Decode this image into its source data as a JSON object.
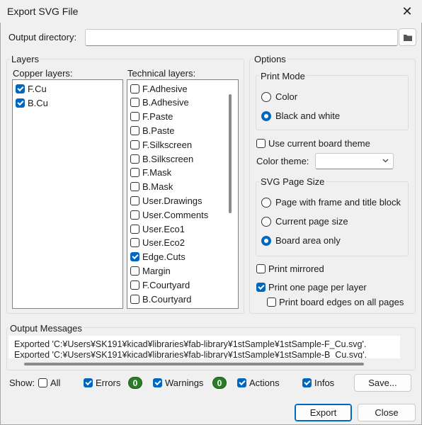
{
  "window": {
    "title": "Export SVG File"
  },
  "output_dir": {
    "label": "Output directory:",
    "value": ""
  },
  "layers": {
    "title": "Layers",
    "copper_label": "Copper layers:",
    "copper": [
      {
        "name": "F.Cu",
        "checked": true
      },
      {
        "name": "B.Cu",
        "checked": true
      }
    ],
    "technical_label": "Technical layers:",
    "technical": [
      {
        "name": "F.Adhesive",
        "checked": false
      },
      {
        "name": "B.Adhesive",
        "checked": false
      },
      {
        "name": "F.Paste",
        "checked": false
      },
      {
        "name": "B.Paste",
        "checked": false
      },
      {
        "name": "F.Silkscreen",
        "checked": false
      },
      {
        "name": "B.Silkscreen",
        "checked": false
      },
      {
        "name": "F.Mask",
        "checked": false
      },
      {
        "name": "B.Mask",
        "checked": false
      },
      {
        "name": "User.Drawings",
        "checked": false
      },
      {
        "name": "User.Comments",
        "checked": false
      },
      {
        "name": "User.Eco1",
        "checked": false
      },
      {
        "name": "User.Eco2",
        "checked": false
      },
      {
        "name": "Edge.Cuts",
        "checked": true
      },
      {
        "name": "Margin",
        "checked": false
      },
      {
        "name": "F.Courtyard",
        "checked": false
      },
      {
        "name": "B.Courtyard",
        "checked": false
      }
    ]
  },
  "options": {
    "title": "Options",
    "print_mode": {
      "title": "Print Mode",
      "color": "Color",
      "bw": "Black and white",
      "selected": "bw"
    },
    "use_board_theme": "Use current board theme",
    "color_theme_label": "Color theme:",
    "color_theme_value": "",
    "page_size": {
      "title": "SVG Page Size",
      "frame": "Page with frame and title block",
      "current": "Current page size",
      "board": "Board area only",
      "selected": "board"
    },
    "print_mirrored": "Print mirrored",
    "one_page_per_layer": "Print one page per layer",
    "board_edges_all": "Print board edges on all pages"
  },
  "messages": {
    "title": "Output Messages",
    "lines": [
      "Exported 'C:¥Users¥SK191¥kicad¥libraries¥fab-library¥1stSample¥1stSample-F_Cu.svg'.",
      "Exported 'C:¥Users¥SK191¥kicad¥libraries¥fab-library¥1stSample¥1stSample-B_Cu.svg'."
    ]
  },
  "filters": {
    "show_label": "Show:",
    "all": "All",
    "errors": "Errors",
    "errors_count": "0",
    "warnings": "Warnings",
    "warnings_count": "0",
    "actions": "Actions",
    "infos": "Infos",
    "save": "Save..."
  },
  "buttons": {
    "export": "Export",
    "close": "Close"
  },
  "colors": {
    "accent": "#0067c0",
    "badge": "#2a7d25"
  }
}
